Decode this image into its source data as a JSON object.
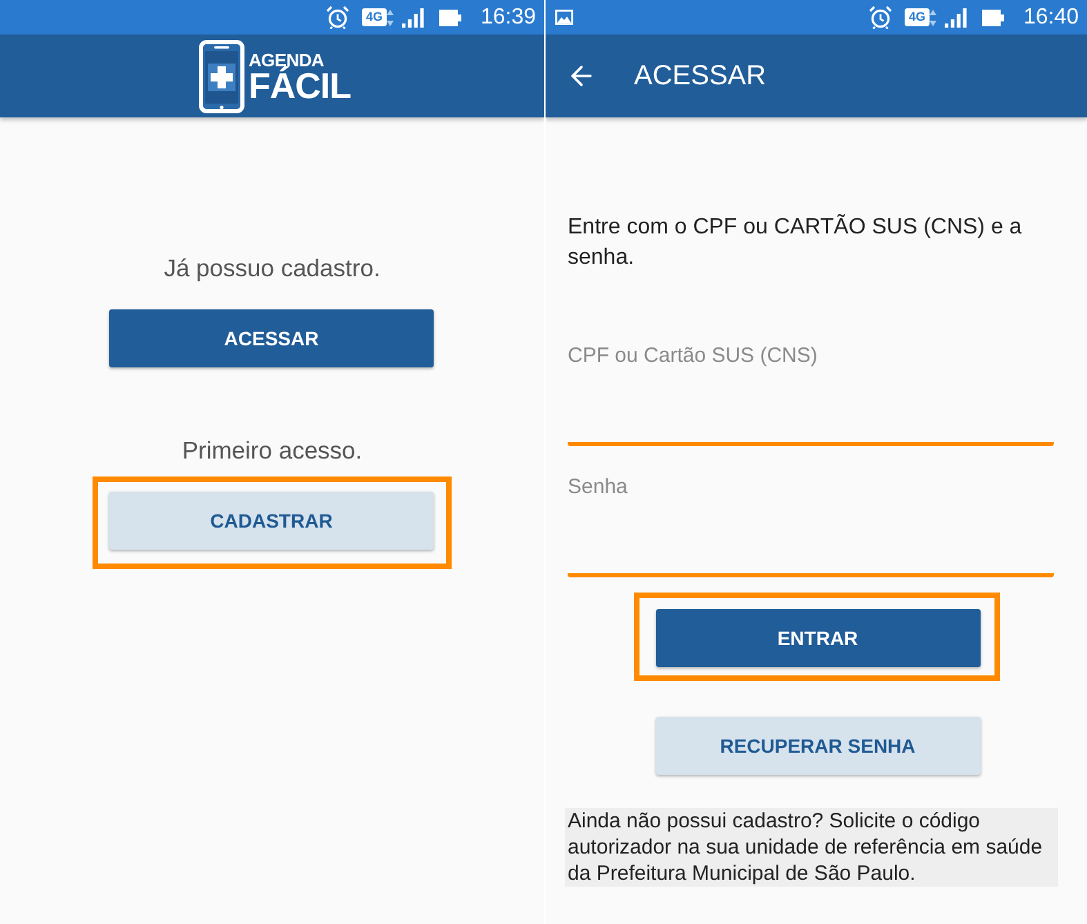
{
  "screens": [
    {
      "kind": "home",
      "status_bar": {
        "network": "4G",
        "time": "16:39"
      },
      "logo": {
        "line_1": "AGENDA",
        "line_2": "FÁCIL"
      },
      "sections": [
        {
          "label": "Já possuo cadastro.",
          "button": {
            "label": "ACESSAR",
            "kind": "primary",
            "highlighted": false
          }
        },
        {
          "label": "Primeiro acesso.",
          "button": {
            "label": "CADASTRAR",
            "kind": "secondary",
            "highlighted": true
          }
        }
      ]
    },
    {
      "kind": "login",
      "status_bar": {
        "notification": true,
        "network": "4G",
        "time": "16:40"
      },
      "app_bar": {
        "title": "ACESSAR"
      },
      "instruction": "Entre com o CPF ou CARTÃO SUS (CNS) e a senha.",
      "fields": [
        {
          "placeholder": "CPF ou Cartão SUS (CNS)",
          "highlighted": true
        },
        {
          "placeholder": "Senha",
          "highlighted": true
        }
      ],
      "buttons": [
        {
          "label": "ENTRAR",
          "kind": "primary",
          "highlighted": true
        },
        {
          "label": "RECUPERAR SENHA",
          "kind": "secondary",
          "highlighted": false
        }
      ],
      "notice": "Ainda não possui cadastro? Solicite o código autorizador na sua unidade de referência em saúde da Prefeitura Municipal de São Paulo."
    }
  ]
}
